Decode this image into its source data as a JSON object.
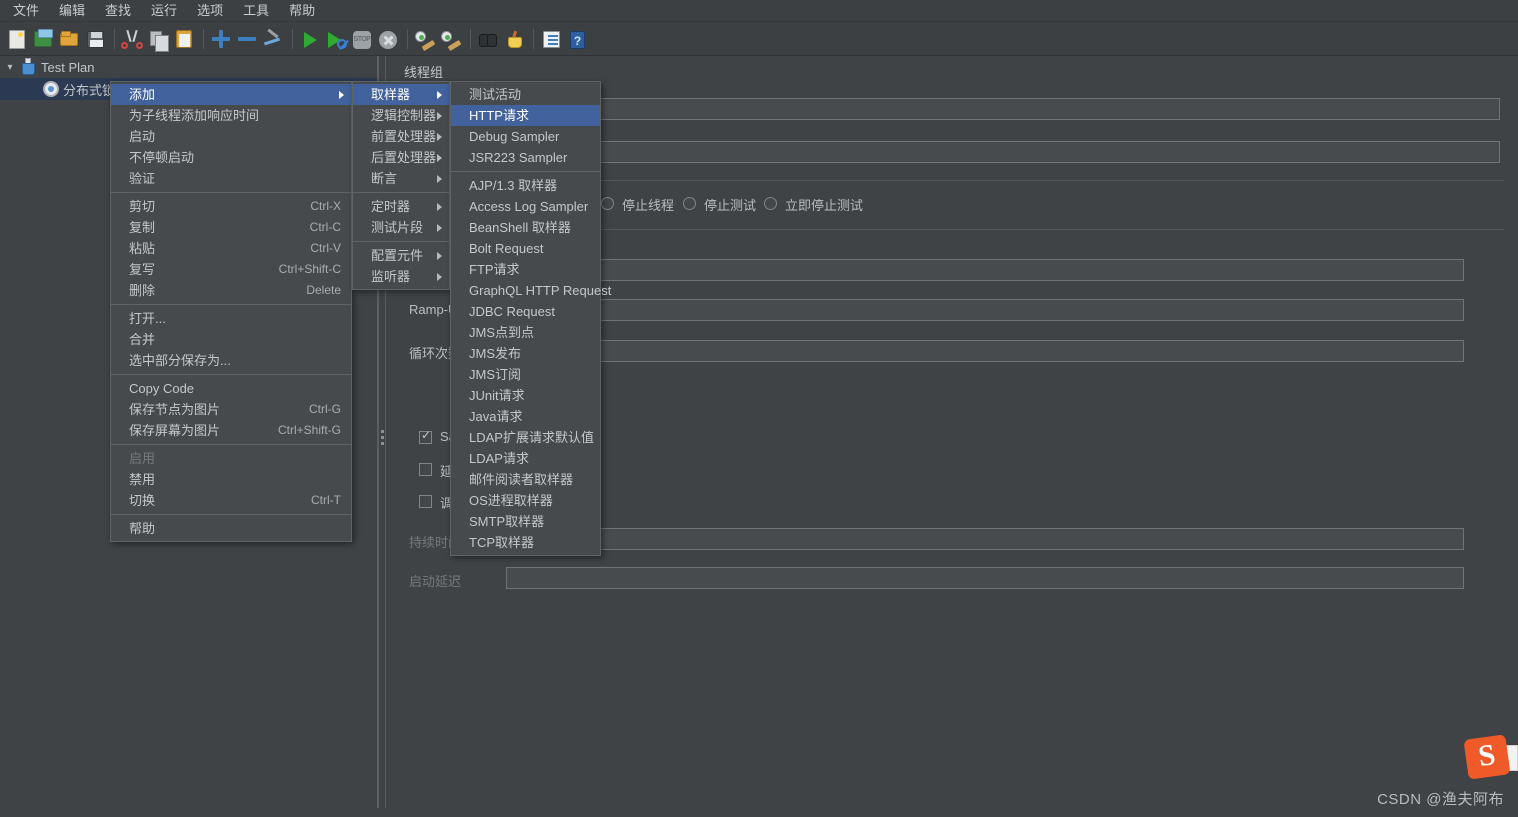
{
  "menubar": {
    "items": [
      "文件",
      "编辑",
      "查找",
      "运行",
      "选项",
      "工具",
      "帮助"
    ]
  },
  "toolbar": {
    "icons": [
      "new-document-icon",
      "new-from-template-icon",
      "open-file-icon",
      "save-icon",
      "cut-icon",
      "copy-icon",
      "paste-icon",
      "expand-icon",
      "collapse-icon",
      "toggle-remote-icon",
      "start-icon",
      "start-no-pauses-icon",
      "stop-icon",
      "shutdown-icon",
      "clear-icon",
      "clear-all-icon",
      "search-icon",
      "search-reset-icon",
      "log-viewer-icon",
      "help-icon"
    ],
    "stop_label": "STOP",
    "help_label": "?"
  },
  "tree": {
    "nodes": [
      {
        "label": "Test Plan",
        "icon": "test-plan-icon",
        "selected": false,
        "expanded": true,
        "indent": 0
      },
      {
        "label": "分布式锁",
        "icon": "thread-group-icon",
        "selected": true,
        "expanded": false,
        "indent": 1
      }
    ]
  },
  "content": {
    "title": "线程组",
    "labels": {
      "ramp_up": "Ramp-Up",
      "loop_count": "循环次数",
      "same_user": "Same",
      "delay_create": "延迟",
      "scheduler": "调度",
      "duration": "持续时间",
      "startup_delay": "启动延迟"
    },
    "radios": [
      "停止线程",
      "停止测试",
      "立即停止测试"
    ],
    "checkboxes": {
      "same_user_checked": true,
      "delay_checked": false,
      "scheduler_checked": false
    }
  },
  "context_menu": {
    "groups": [
      [
        {
          "label": "添加",
          "accel": "",
          "submenu": true,
          "selected": true,
          "disabled": false
        },
        {
          "label": "为子线程添加响应时间",
          "accel": "",
          "submenu": false,
          "selected": false,
          "disabled": false
        },
        {
          "label": "启动",
          "accel": "",
          "submenu": false,
          "selected": false,
          "disabled": false
        },
        {
          "label": "不停顿启动",
          "accel": "",
          "submenu": false,
          "selected": false,
          "disabled": false
        },
        {
          "label": "验证",
          "accel": "",
          "submenu": false,
          "selected": false,
          "disabled": false
        }
      ],
      [
        {
          "label": "剪切",
          "accel": "Ctrl-X",
          "submenu": false,
          "selected": false,
          "disabled": false
        },
        {
          "label": "复制",
          "accel": "Ctrl-C",
          "submenu": false,
          "selected": false,
          "disabled": false
        },
        {
          "label": "粘贴",
          "accel": "Ctrl-V",
          "submenu": false,
          "selected": false,
          "disabled": false
        },
        {
          "label": "复写",
          "accel": "Ctrl+Shift-C",
          "submenu": false,
          "selected": false,
          "disabled": false
        },
        {
          "label": "删除",
          "accel": "Delete",
          "submenu": false,
          "selected": false,
          "disabled": false
        }
      ],
      [
        {
          "label": "打开...",
          "accel": "",
          "submenu": false,
          "selected": false,
          "disabled": false
        },
        {
          "label": "合并",
          "accel": "",
          "submenu": false,
          "selected": false,
          "disabled": false
        },
        {
          "label": "选中部分保存为...",
          "accel": "",
          "submenu": false,
          "selected": false,
          "disabled": false
        }
      ],
      [
        {
          "label": "Copy Code",
          "accel": "",
          "submenu": false,
          "selected": false,
          "disabled": false
        },
        {
          "label": "保存节点为图片",
          "accel": "Ctrl-G",
          "submenu": false,
          "selected": false,
          "disabled": false
        },
        {
          "label": "保存屏幕为图片",
          "accel": "Ctrl+Shift-G",
          "submenu": false,
          "selected": false,
          "disabled": false
        }
      ],
      [
        {
          "label": "启用",
          "accel": "",
          "submenu": false,
          "selected": false,
          "disabled": true
        },
        {
          "label": "禁用",
          "accel": "",
          "submenu": false,
          "selected": false,
          "disabled": false
        },
        {
          "label": "切换",
          "accel": "Ctrl-T",
          "submenu": false,
          "selected": false,
          "disabled": false
        }
      ],
      [
        {
          "label": "帮助",
          "accel": "",
          "submenu": false,
          "selected": false,
          "disabled": false
        }
      ]
    ]
  },
  "add_menu": {
    "groups": [
      [
        {
          "label": "取样器",
          "submenu": true,
          "selected": true
        },
        {
          "label": "逻辑控制器",
          "submenu": true,
          "selected": false
        },
        {
          "label": "前置处理器",
          "submenu": true,
          "selected": false
        },
        {
          "label": "后置处理器",
          "submenu": true,
          "selected": false
        },
        {
          "label": "断言",
          "submenu": true,
          "selected": false
        }
      ],
      [
        {
          "label": "定时器",
          "submenu": true,
          "selected": false
        },
        {
          "label": "测试片段",
          "submenu": true,
          "selected": false
        }
      ],
      [
        {
          "label": "配置元件",
          "submenu": true,
          "selected": false
        },
        {
          "label": "监听器",
          "submenu": true,
          "selected": false
        }
      ]
    ]
  },
  "sampler_menu": {
    "groups": [
      [
        {
          "label": "测试活动",
          "selected": false
        },
        {
          "label": "HTTP请求",
          "selected": true
        },
        {
          "label": "Debug Sampler",
          "selected": false
        },
        {
          "label": "JSR223 Sampler",
          "selected": false
        }
      ],
      [
        {
          "label": "AJP/1.3 取样器",
          "selected": false
        },
        {
          "label": "Access Log Sampler",
          "selected": false
        },
        {
          "label": "BeanShell 取样器",
          "selected": false
        },
        {
          "label": "Bolt Request",
          "selected": false
        },
        {
          "label": "FTP请求",
          "selected": false
        },
        {
          "label": "GraphQL HTTP Request",
          "selected": false
        },
        {
          "label": "JDBC Request",
          "selected": false
        },
        {
          "label": "JMS点到点",
          "selected": false
        },
        {
          "label": "JMS发布",
          "selected": false
        },
        {
          "label": "JMS订阅",
          "selected": false
        },
        {
          "label": "JUnit请求",
          "selected": false
        },
        {
          "label": "Java请求",
          "selected": false
        },
        {
          "label": "LDAP扩展请求默认值",
          "selected": false
        },
        {
          "label": "LDAP请求",
          "selected": false
        },
        {
          "label": "邮件阅读者取样器",
          "selected": false
        },
        {
          "label": "OS进程取样器",
          "selected": false
        },
        {
          "label": "SMTP取样器",
          "selected": false
        },
        {
          "label": "TCP取样器",
          "selected": false
        }
      ]
    ]
  },
  "watermark": {
    "text": "CSDN @渔夫阿布",
    "logo_letter": "S"
  },
  "colors": {
    "background": "#3f4346",
    "panel": "#3c4043",
    "menu_bg": "#464a4d",
    "highlight": "#41629d",
    "tree_selection": "#2b3a52",
    "text": "#c4c8cb",
    "text_dim": "#76797c",
    "border": "#5e6366"
  }
}
